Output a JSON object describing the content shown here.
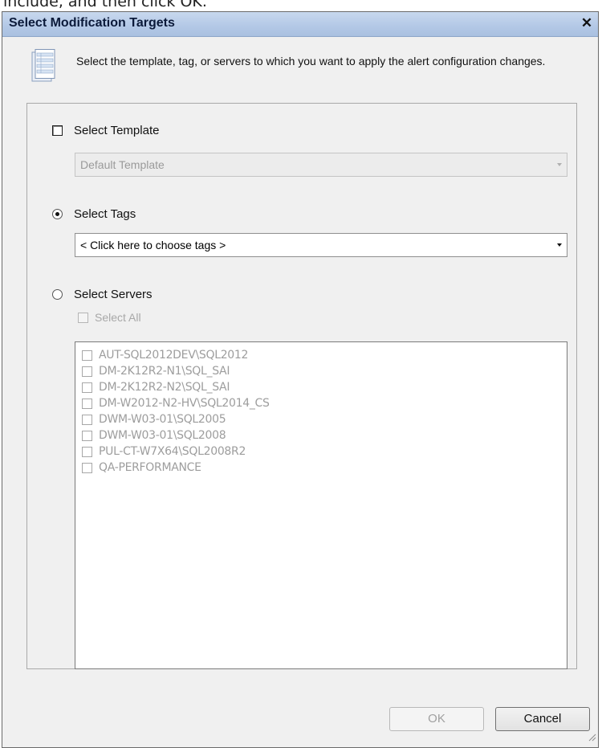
{
  "page_caption": "include, and then click OK.",
  "window": {
    "title": "Select Modification Targets",
    "close_glyph": "✕"
  },
  "header": {
    "icon": "document-list-icon",
    "instructions": "Select the template, tag, or servers to which you want to apply the alert configuration changes."
  },
  "options": {
    "template": {
      "label": "Select Template",
      "checked": false,
      "combo_value": "Default Template",
      "combo_enabled": false
    },
    "tags": {
      "label": "Select Tags",
      "selected": true,
      "combo_value": "< Click here to choose tags >"
    },
    "servers": {
      "label": "Select Servers",
      "selected": false,
      "select_all_label": "Select All",
      "items": [
        "AUT-SQL2012DEV\\SQL2012",
        "DM-2K12R2-N1\\SQL_SAI",
        "DM-2K12R2-N2\\SQL_SAI",
        "DM-W2012-N2-HV\\SQL2014_CS",
        "DWM-W03-01\\SQL2005",
        "DWM-W03-01\\SQL2008",
        "PUL-CT-W7X64\\SQL2008R2",
        "QA-PERFORMANCE"
      ]
    }
  },
  "buttons": {
    "ok": "OK",
    "cancel": "Cancel"
  },
  "colors": {
    "titlebar": "#b3c8e6",
    "dialog_bg": "#f0f0f0",
    "disabled_text": "#9d9d9d"
  }
}
